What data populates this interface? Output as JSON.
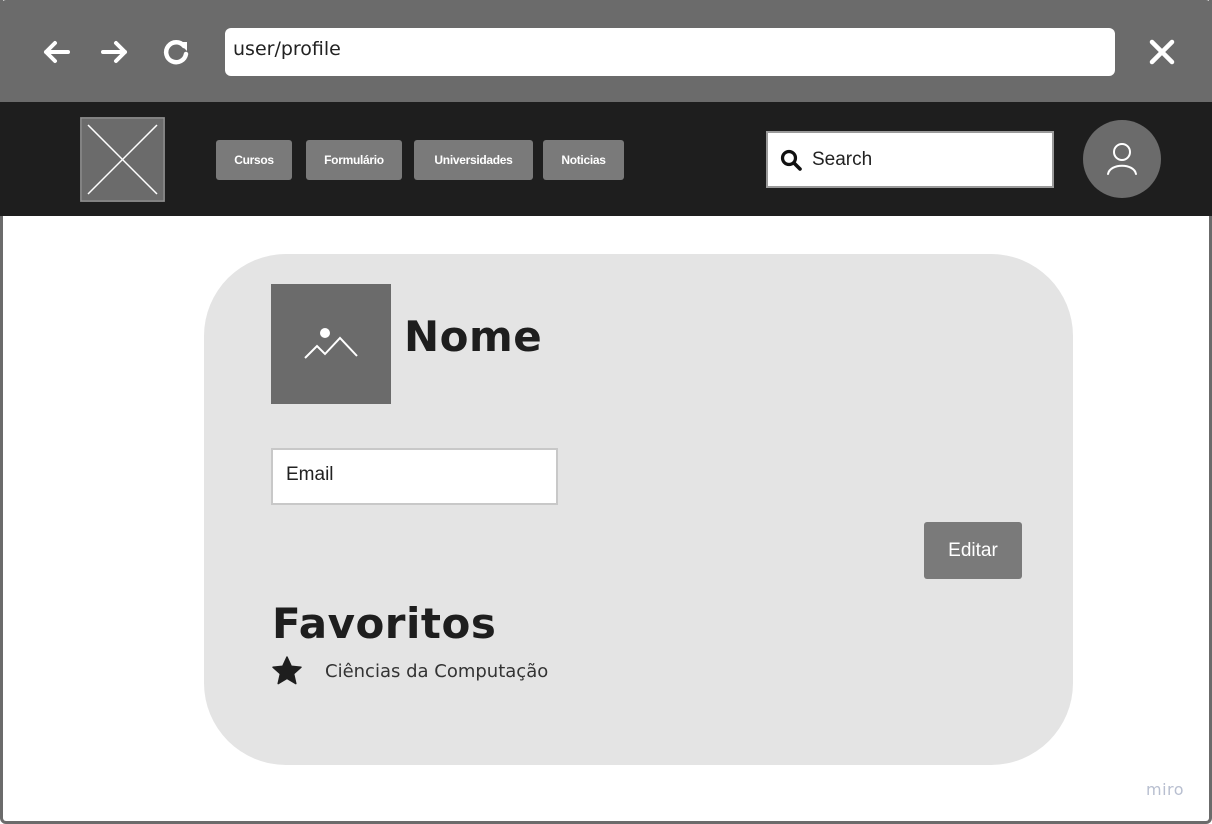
{
  "browser": {
    "url": "user/profile",
    "icons": [
      "back-arrow-icon",
      "forward-arrow-icon",
      "refresh-icon",
      "close-icon"
    ]
  },
  "header": {
    "logo_icon": "image-placeholder-icon",
    "menu": [
      {
        "label": "Cursos"
      },
      {
        "label": "Formulário"
      },
      {
        "label": "Universidades"
      },
      {
        "label": "Noticias"
      }
    ],
    "search": {
      "placeholder": "Search",
      "icon": "search-icon"
    },
    "avatar_icon": "user-icon"
  },
  "profile": {
    "name": "Nome",
    "email_placeholder": "Email",
    "edit_label": "Editar",
    "image_icon": "image-icon"
  },
  "favorites": {
    "heading": "Favoritos",
    "items": [
      {
        "label": "Ciências da Computação",
        "icon": "star-icon"
      }
    ]
  },
  "watermark": "miro",
  "colors": {
    "chrome": "#6b6b6b",
    "header_bg": "#1e1e1e",
    "button_bg": "#7a7a7a",
    "card_bg": "#e4e4e4"
  }
}
